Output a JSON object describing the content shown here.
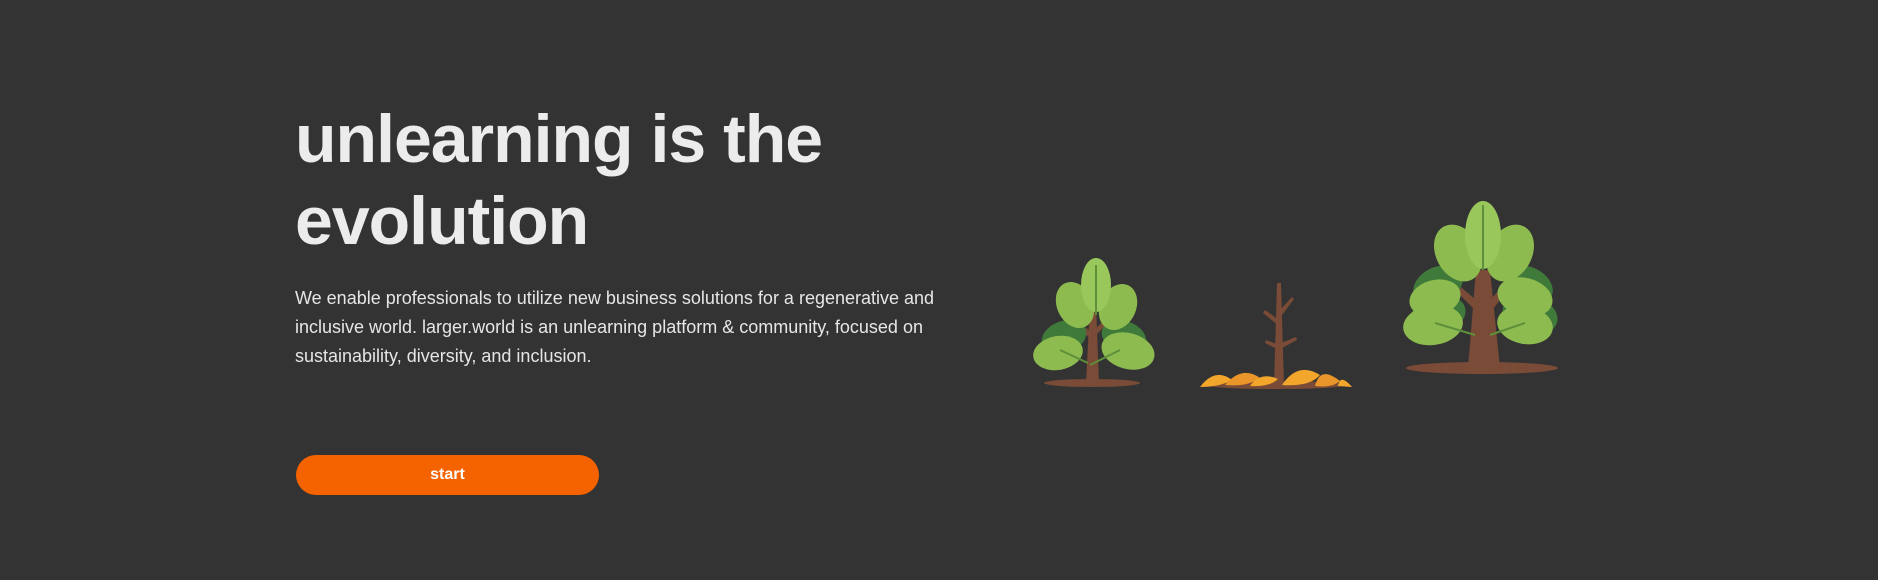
{
  "hero": {
    "headline_line1": "unlearning is the",
    "headline_line2": "evolution",
    "description_line1": "We enable professionals to utilize new business solutions for a regenerative and",
    "description_line2": "inclusive world. larger.world is an unlearning platform & community, focused on",
    "description_line3": "sustainability, diversity, and inclusion.",
    "cta_label": "start"
  },
  "illustration": {
    "items": [
      "young-tree-icon",
      "bare-sapling-with-fallen-leaves-icon",
      "mature-tree-icon"
    ]
  },
  "colors": {
    "background": "#333333",
    "text": "#ececec",
    "accent": "#f56200",
    "leaf_light": "#8dbb4f",
    "leaf_dark": "#3f7a3a",
    "trunk": "#7a4b36",
    "fallen_leaves": "#f2a62b"
  }
}
